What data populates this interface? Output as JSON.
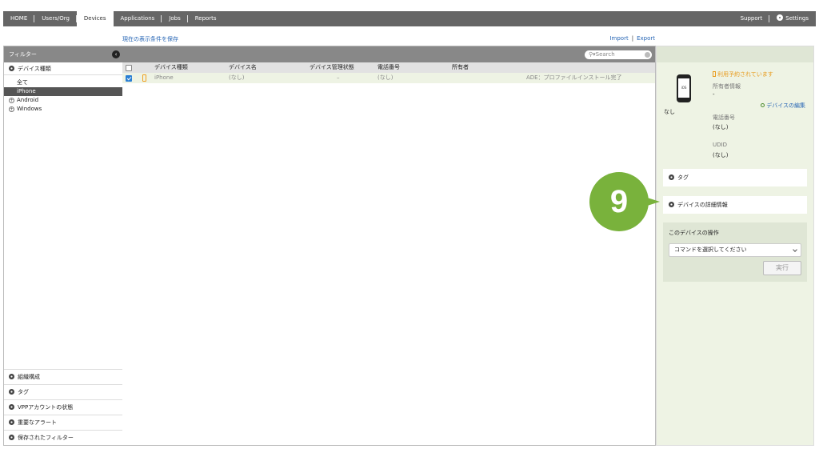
{
  "nav": {
    "items": [
      "HOME",
      "Users/Org",
      "Devices",
      "Applications",
      "Jobs",
      "Reports"
    ],
    "active": "Devices",
    "support": "Support",
    "settings": "Settings"
  },
  "toolbar": {
    "save_view": "現在の表示条件を保存",
    "import": "Import",
    "separator": "|",
    "export": "Export"
  },
  "filter": {
    "header": "フィルター",
    "collapse_icon": "‹",
    "device_type_section": "デバイス種類",
    "types": [
      {
        "label": "全て"
      },
      {
        "label": "iPhone",
        "selected": true
      },
      {
        "label": "Android",
        "expandable": true
      },
      {
        "label": "Windows",
        "expandable": true
      }
    ],
    "bottom_sections": [
      "組織構成",
      "タグ",
      "VPPアカウントの状態",
      "重要なアラート",
      "保存されたフィルター"
    ]
  },
  "table": {
    "search_placeholder": "Search",
    "headers": [
      "デバイス種類",
      "デバイス名",
      "デバイス管理状態",
      "電話番号",
      "所有者"
    ],
    "rows": [
      {
        "type": "iPhone",
        "name": "(なし)",
        "status": "–",
        "phone": "(なし)",
        "owner": "",
        "note": "ADE：プロファイルインストール完了",
        "checked": true
      }
    ]
  },
  "detail": {
    "device_label": "なし",
    "reserved": "利用予約されています",
    "owner_label": "所有者情報",
    "owner_value": "-",
    "edit_link": "デバイスの編集",
    "phone_label": "電話番号",
    "phone_value": "(なし)",
    "udid_label": "UDID",
    "udid_value": "(なし)",
    "tag_section": "タグ",
    "detail_section": "デバイスの詳細情報",
    "ops_title": "このデバイスの操作",
    "ops_select": "コマンドを選択してください",
    "run_button": "実行"
  },
  "callout": {
    "number": "9",
    "color": "#79b23c"
  },
  "colors": {
    "nav_bg": "#666666",
    "accent_link": "#2766b5",
    "panel_green": "#eef3e4",
    "warning_orange": "#e89a1a"
  }
}
